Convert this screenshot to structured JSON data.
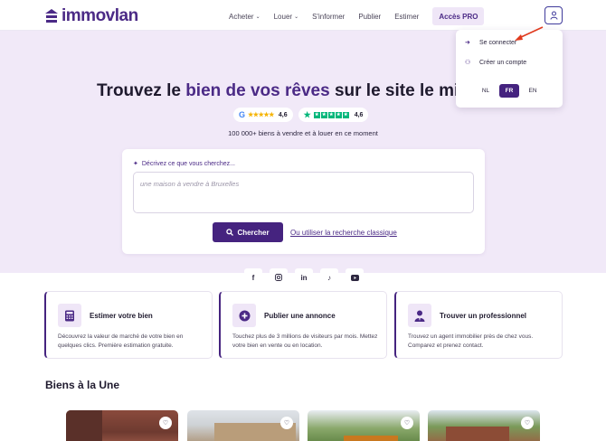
{
  "header": {
    "logo_text": "immovlan",
    "nav": {
      "buy": "Acheter",
      "rent": "Louer",
      "inform": "S'informer",
      "publish": "Publier",
      "estimate": "Estimer",
      "pro": "Accès PRO"
    }
  },
  "user_menu": {
    "login": "Se connecter",
    "create_account": "Créer un compte",
    "languages": [
      "NL",
      "FR",
      "EN"
    ],
    "active_language": "FR"
  },
  "hero": {
    "title_part1": "Trouvez le ",
    "title_accent": "bien de vos rêves",
    "title_part2": " sur le site le mieux",
    "google_rating": "4,6",
    "trustpilot_rating": "4,6",
    "subtitle": "100 000+ biens à vendre et à louer en ce moment"
  },
  "search": {
    "label": "Décrivez ce que vous cherchez...",
    "placeholder": "une maison à vendre à Bruxelles",
    "button": "Chercher",
    "classic_link": "Ou utiliser la recherche classique"
  },
  "socials": [
    "facebook-icon",
    "instagram-icon",
    "linkedin-icon",
    "tiktok-icon",
    "youtube-icon"
  ],
  "features": [
    {
      "title": "Estimer votre bien",
      "desc": "Découvrez la valeur de marché de votre bien en quelques clics. Première estimation gratuite.",
      "icon": "calculator-icon"
    },
    {
      "title": "Publier une annonce",
      "desc": "Touchez plus de 3 millions de visiteurs par mois. Mettez votre bien en vente ou en location.",
      "icon": "plus-circle-icon"
    },
    {
      "title": "Trouver un professionnel",
      "desc": "Trouvez un agent immobilier près de chez vous. Comparez et prenez contact.",
      "icon": "agent-icon"
    }
  ],
  "featured": {
    "title": "Biens à la Une"
  },
  "colors": {
    "brand": "#4b2a86",
    "hero_bg": "#f1e9f8",
    "button": "#45237f",
    "arrow": "#e03a1e"
  }
}
